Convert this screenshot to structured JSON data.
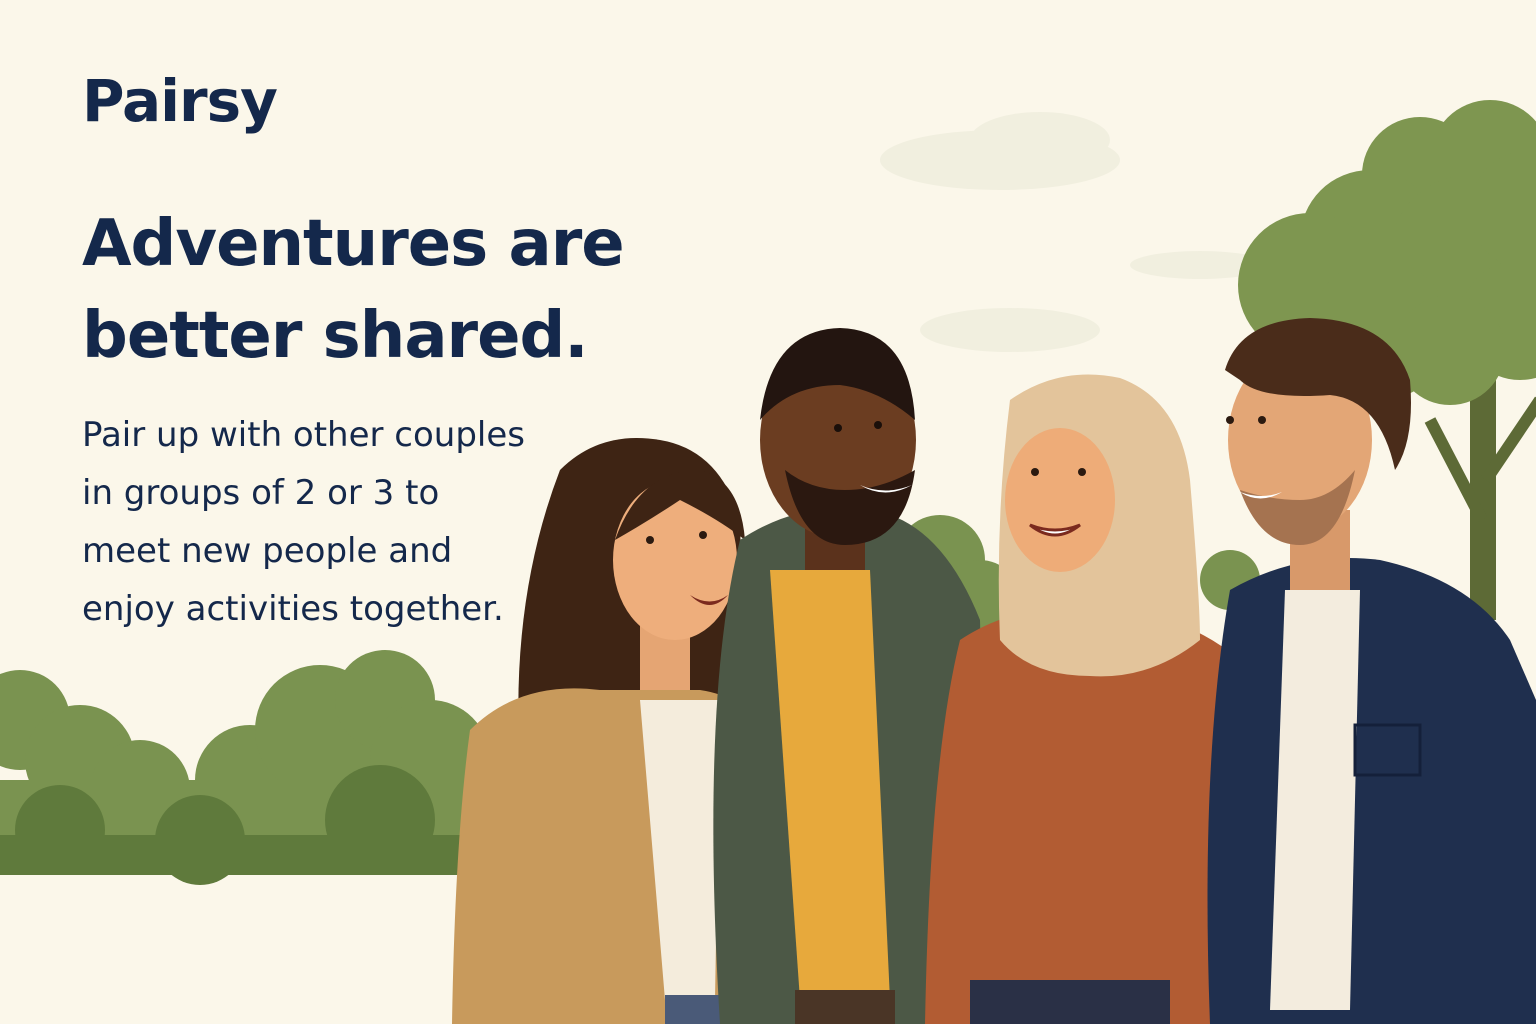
{
  "brand": {
    "name": "Pairsy"
  },
  "hero": {
    "headline_lines": [
      "Adventures are",
      "better shared."
    ],
    "subtext_lines": [
      "Pair up with other couples",
      "in groups of 2 or 3 to",
      "meet new people and",
      "enjoy activities together."
    ]
  },
  "colors": {
    "background": "#fbf7ea",
    "text": "#14284b",
    "foliage": "#6f8c4a"
  },
  "illustration": {
    "description_icons": [
      "tree-icon",
      "bush-icon",
      "person-icon"
    ]
  }
}
